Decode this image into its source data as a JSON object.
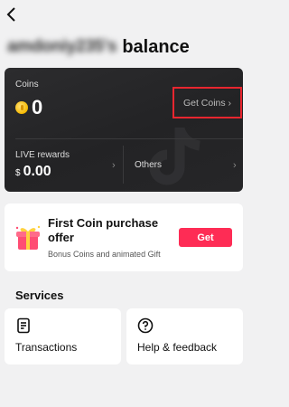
{
  "header": {
    "back_icon": "chevron-left-icon",
    "username_blurred": "amdoniy235's",
    "title_suffix": "balance"
  },
  "balance_card": {
    "coins_label": "Coins",
    "coins_value": "0",
    "coin_icon": "gold-coin-icon",
    "get_coins_label": "Get Coins ›",
    "get_coins_highlight_color": "#e8262f",
    "live_rewards_label": "LIVE rewards",
    "live_rewards_currency": "$",
    "live_rewards_value": "0.00",
    "live_rewards_chevron": "›",
    "others_label": "Others",
    "others_chevron": "›"
  },
  "offer": {
    "title": "First Coin purchase offer",
    "subtitle": "Bonus Coins and animated Gift",
    "button_label": "Get",
    "button_color": "#fe2c55",
    "icon": "gift-icon"
  },
  "services": {
    "heading": "Services",
    "items": [
      {
        "label": "Transactions",
        "icon": "receipt-icon"
      },
      {
        "label": "Help & feedback",
        "icon": "question-circle-icon"
      }
    ]
  }
}
